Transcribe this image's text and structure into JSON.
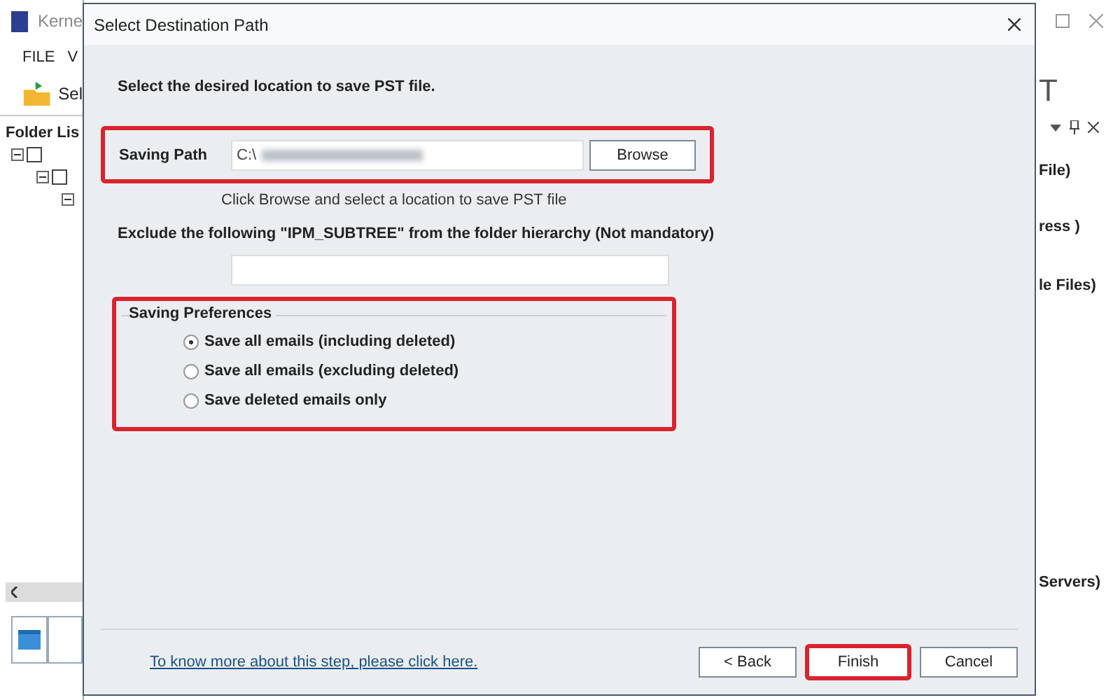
{
  "app": {
    "title": "Kerne",
    "menu": [
      "FILE",
      "V"
    ],
    "toolbar_button": "Sel",
    "folder_list": {
      "title": "Folder Lis",
      "tree": [
        {
          "checked": false,
          "expanded": true,
          "children": [
            {
              "checked": false,
              "expanded": true,
              "children": [
                {
                  "expanded": true
                }
              ]
            }
          ]
        }
      ]
    },
    "right_panel": {
      "heading": "T",
      "items": [
        "File)",
        "ress )",
        "le Files)",
        "Servers)"
      ]
    }
  },
  "dialog": {
    "title": "Select Destination Path",
    "instruction": "Select the desired location to save PST file.",
    "saving_path": {
      "label": "Saving Path",
      "value": "C:\\",
      "browse": "Browse"
    },
    "hint": "Click Browse and select a location to save PST file",
    "exclude": {
      "label": "Exclude the following \"IPM_SUBTREE\" from the folder hierarchy (Not mandatory)"
    },
    "preferences": {
      "title": "Saving Preferences",
      "options": [
        {
          "label": "Save all emails (including deleted)",
          "selected": true
        },
        {
          "label": "Save all emails (excluding deleted)",
          "selected": false
        },
        {
          "label": "Save deleted emails only",
          "selected": false
        }
      ]
    },
    "help_link": "To know more about this step, please click here.",
    "buttons": [
      {
        "label": "< Back",
        "highlighted": false
      },
      {
        "label": "Finish",
        "highlighted": true
      },
      {
        "label": "Cancel",
        "highlighted": false
      }
    ]
  }
}
